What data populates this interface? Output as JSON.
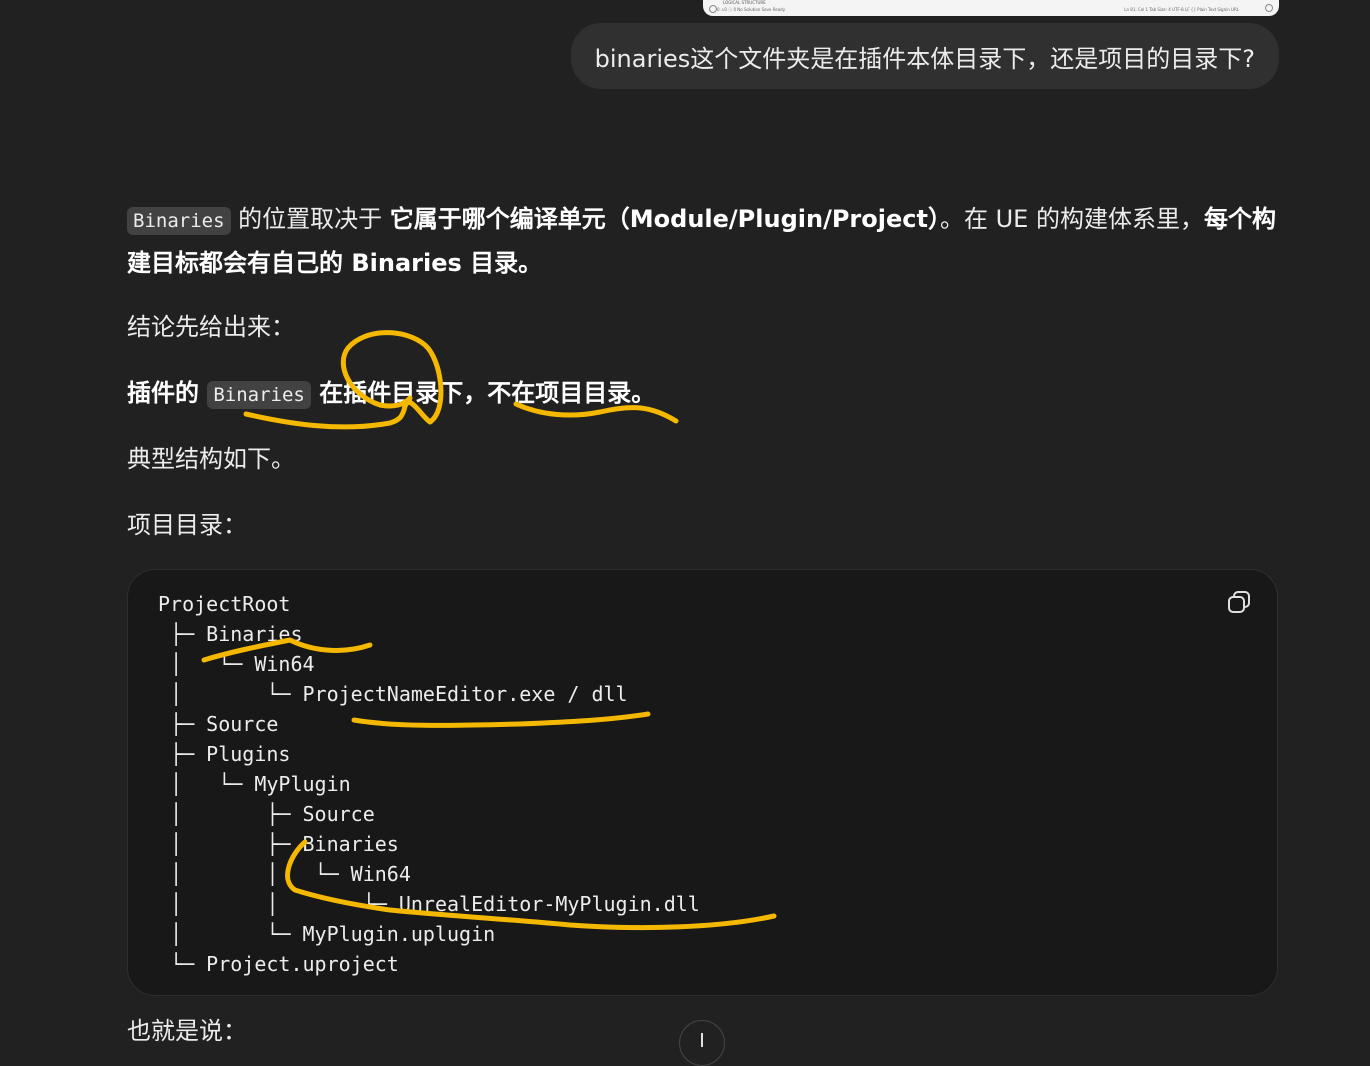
{
  "thumbnail": {
    "row1": "LOGICAL STRUCTURE",
    "row2": "0 ⚠0 ⓘ 0    No Solution    Save Ready",
    "row3": "Ln 81, Col 1   Tab Size: 4   UTF-8   LF   {}  Plain Text   Signin URL"
  },
  "user_message": "binaries这个文件夹是在插件本体目录下，还是项目的目录下?",
  "answer": {
    "p1": {
      "code": "Binaries",
      "text1": " 的位置取决于 ",
      "bold1": "它属于哪个编译单元（Module/Plugin/Project）",
      "text2": "。在 UE 的构建体系里，",
      "bold2": "每个构建目标都会有自己的 Binaries 目录。"
    },
    "p2": "结论先给出来：",
    "p3": {
      "bold1": "插件的 ",
      "code": "Binaries",
      "bold2": " 在插件目录下，不在项目目录。"
    },
    "p4": "典型结构如下。",
    "p5": "项目目录：",
    "code_block": "ProjectRoot\n ├─ Binaries\n │   └─ Win64\n │       └─ ProjectNameEditor.exe / dll\n ├─ Source\n ├─ Plugins\n │   └─ MyPlugin\n │       ├─ Source\n │       ├─ Binaries\n │       │   └─ Win64\n │       │       └─ UnrealEditor-MyPlugin.dll\n │       └─ MyPlugin.uplugin\n └─ Project.uproject",
    "p6": "也就是说："
  },
  "icons": {
    "copy": "copy-icon",
    "scroll": "arrow-down-icon"
  },
  "colors": {
    "background": "#212121",
    "bubble": "#303030",
    "code_bg": "#181818",
    "highlight_stroke": "#f5b800"
  }
}
